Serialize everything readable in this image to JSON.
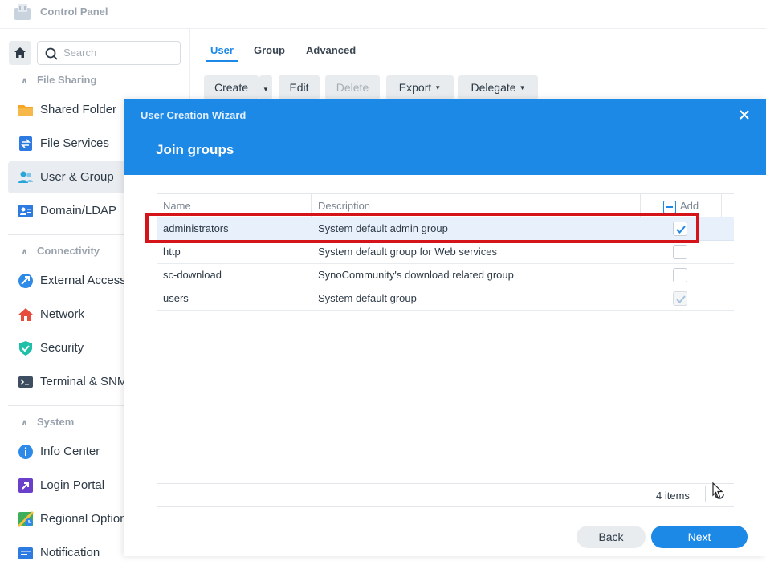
{
  "app": {
    "title": "Control Panel"
  },
  "sidebar": {
    "search_placeholder": "Search",
    "sections": [
      {
        "label": "File Sharing"
      },
      {
        "label": "Connectivity"
      },
      {
        "label": "System"
      }
    ],
    "items": [
      {
        "label": "Shared Folder",
        "icon": "folder-icon"
      },
      {
        "label": "File Services",
        "icon": "file-services-icon"
      },
      {
        "label": "User & Group",
        "icon": "users-icon",
        "active": true
      },
      {
        "label": "Domain/LDAP",
        "icon": "domain-icon"
      },
      {
        "label": "External Access",
        "icon": "external-access-icon"
      },
      {
        "label": "Network",
        "icon": "house-network-icon"
      },
      {
        "label": "Security",
        "icon": "shield-icon"
      },
      {
        "label": "Terminal & SNMP",
        "icon": "terminal-icon"
      },
      {
        "label": "Info Center",
        "icon": "info-icon"
      },
      {
        "label": "Login Portal",
        "icon": "login-portal-icon"
      },
      {
        "label": "Regional Options",
        "icon": "regional-icon"
      },
      {
        "label": "Notification",
        "icon": "notification-icon"
      }
    ]
  },
  "main": {
    "tabs": [
      {
        "label": "User",
        "active": true
      },
      {
        "label": "Group"
      },
      {
        "label": "Advanced"
      }
    ],
    "toolbar": {
      "create": "Create",
      "edit": "Edit",
      "delete": "Delete",
      "export": "Export",
      "delegate": "Delegate"
    }
  },
  "dialog": {
    "title": "User Creation Wizard",
    "step_title": "Join groups",
    "columns": {
      "name": "Name",
      "description": "Description",
      "add": "Add"
    },
    "rows": [
      {
        "name": "administrators",
        "description": "System default admin group",
        "add": true,
        "selected": true
      },
      {
        "name": "http",
        "description": "System default group for Web services",
        "add": false
      },
      {
        "name": "sc-download",
        "description": "SynoCommunity's download related group",
        "add": false
      },
      {
        "name": "users",
        "description": "System default group",
        "add": true,
        "locked": true
      }
    ],
    "items_count": "4 items",
    "back_label": "Back",
    "next_label": "Next"
  },
  "colors": {
    "accent": "#1d89e6",
    "highlight": "#d5141a"
  }
}
